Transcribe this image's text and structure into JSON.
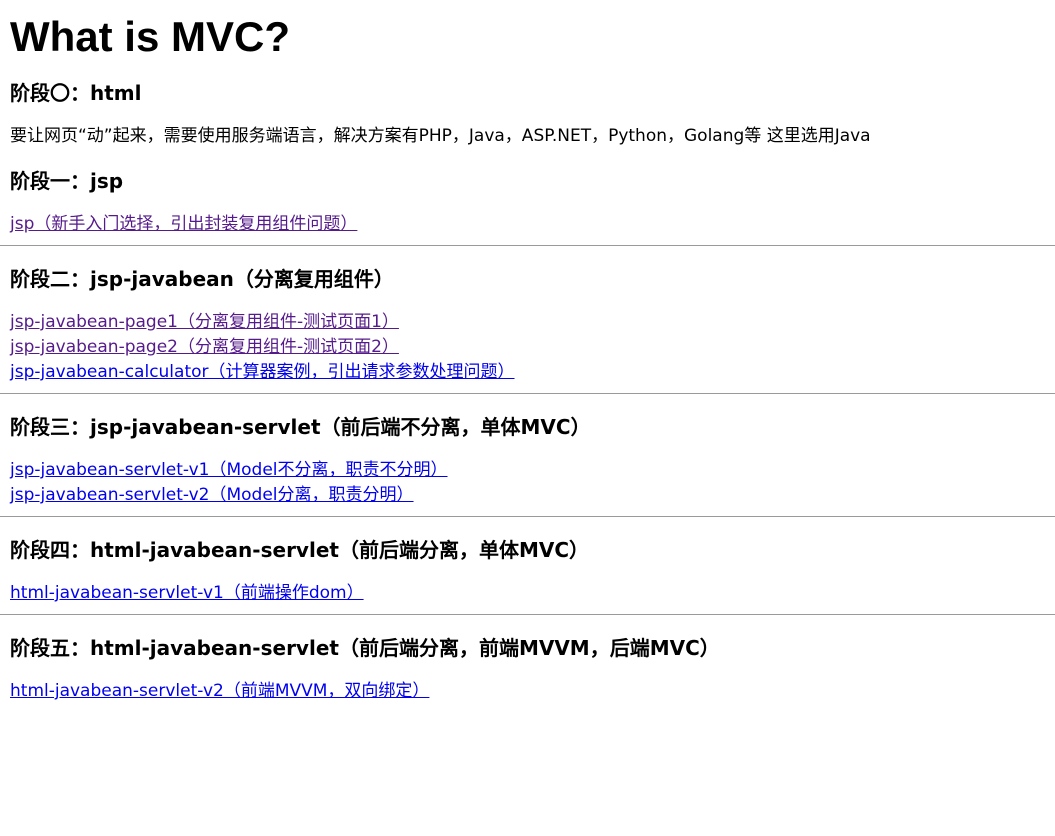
{
  "page_title": "What is MVC?",
  "sections": [
    {
      "heading": "阶段〇：html",
      "text": "要让网页“动”起来，需要使用服务端语言，解决方案有PHP，Java，ASP.NET，Python，Golang等 这里选用Java"
    },
    {
      "heading": "阶段一：jsp",
      "links": [
        "jsp（新手入门选择，引出封装复用组件问题）"
      ]
    },
    {
      "heading": "阶段二：jsp-javabean（分离复用组件）",
      "links": [
        "jsp-javabean-page1（分离复用组件-测试页面1）",
        "jsp-javabean-page2（分离复用组件-测试页面2）",
        "jsp-javabean-calculator（计算器案例，引出请求参数处理问题）"
      ]
    },
    {
      "heading": "阶段三：jsp-javabean-servlet（前后端不分离，单体MVC）",
      "links": [
        "jsp-javabean-servlet-v1（Model不分离，职责不分明）",
        "jsp-javabean-servlet-v2（Model分离，职责分明）"
      ]
    },
    {
      "heading": "阶段四：html-javabean-servlet（前后端分离，单体MVC）",
      "links": [
        "html-javabean-servlet-v1（前端操作dom）"
      ]
    },
    {
      "heading": "阶段五：html-javabean-servlet（前后端分离，前端MVVM，后端MVC）",
      "links": [
        "html-javabean-servlet-v2（前端MVVM，双向绑定）"
      ]
    }
  ],
  "colors": {
    "link": "#0000ee",
    "visited_link": "#551a8b",
    "divider": "#9a9a9a"
  }
}
